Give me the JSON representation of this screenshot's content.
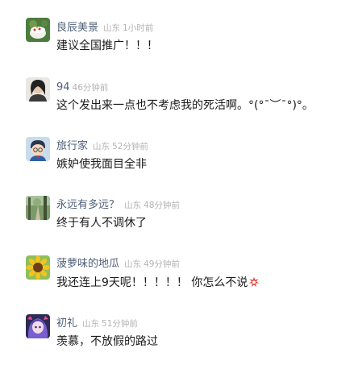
{
  "comments": [
    {
      "user": "良辰美景",
      "location": "山东",
      "time": "1小时前",
      "text": "建议全国推广！！！"
    },
    {
      "user": "94",
      "location": "",
      "time": "46分钟前",
      "text": "这个发出来一点也不考虑我的死活啊。°(°¯︶¯°)°。"
    },
    {
      "user": "旅行家",
      "location": "山东",
      "time": "52分钟前",
      "text": "嫉妒使我面目全非"
    },
    {
      "user": "永远有多远？",
      "location": "山东",
      "time": "48分钟前",
      "text": "终于有人不调休了"
    },
    {
      "user": "菠萝味的地瓜",
      "location": "山东",
      "time": "49分钟前",
      "text": "我还连上9天呢！！！！！ 你怎么不说",
      "emoji": "angry-emoji"
    },
    {
      "user": "初礼",
      "location": "山东",
      "time": "51分钟前",
      "text": "羡慕，不放假的路过"
    }
  ],
  "colors": {
    "username": "#4f5f78",
    "meta": "#b2b2b2",
    "text": "#1a1a1a",
    "emoji": "#e0443c"
  }
}
